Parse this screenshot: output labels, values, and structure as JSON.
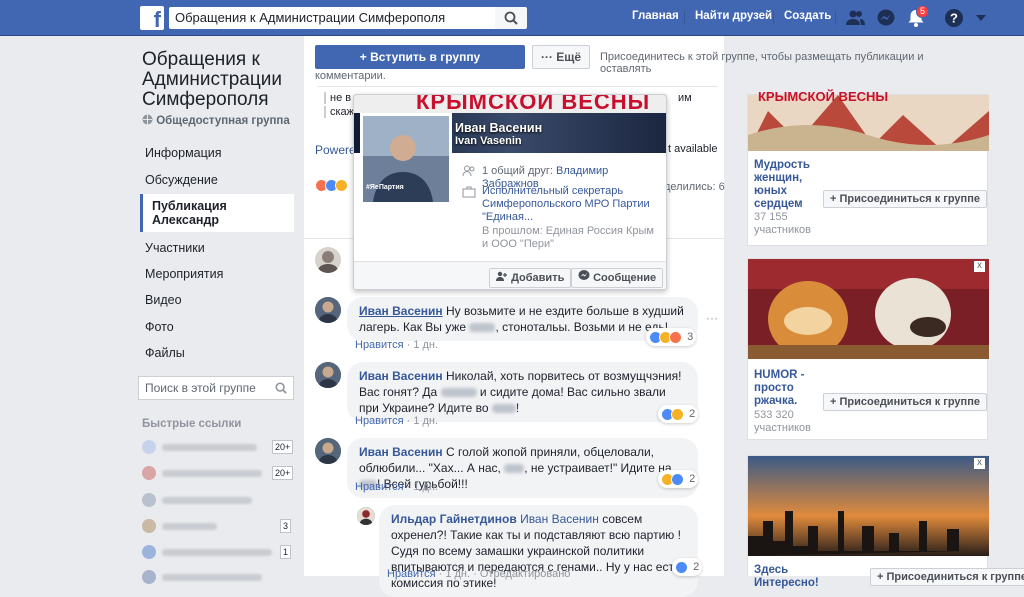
{
  "topbar": {
    "search_value": "Обращения к Администрации Симферополя",
    "nav": [
      "Главная",
      "Найти друзей",
      "Создать"
    ],
    "notif_count": "5",
    "icons": [
      "friends-icon",
      "messenger-icon",
      "bell-icon",
      "help-icon",
      "chevron-down-icon"
    ]
  },
  "group": {
    "title": "Обращения к Администрации Симферополя",
    "type": "Общедоступная группа",
    "join_label": "+ Вступить в группу",
    "more_label": "··· Ещё",
    "join_note_1": "Присоединитесь к этой группе, чтобы размещать публикации и оставлять",
    "join_note_2": "комментарии."
  },
  "menu": [
    "Информация",
    "Обсуждение",
    "Публикация Александр",
    "Участники",
    "Мероприятия",
    "Видео",
    "Фото",
    "Файлы"
  ],
  "group_search_placeholder": "Поиск в этой группе",
  "quick_links": {
    "title": "Быстрые ссылки",
    "counts": [
      "20+",
      "20+",
      "",
      "3",
      "1",
      ""
    ]
  },
  "post_fragments": {
    "line1": "не в",
    "line1b": "им",
    "line2": "скажу",
    "powered": "Powere",
    "not_avail": "t available",
    "shares": "делились: 6"
  },
  "hovercard": {
    "name": "Иван Васенин",
    "name_latin": "Ivan Vasenin",
    "banner_text": "КРЫМСКОЙ ВЕСНЫ",
    "photo_caption": "#ЯеПартия",
    "mutual_prefix": "1 общий друг:",
    "mutual_name": "Владимир Забражнов",
    "job": "Исполнительный секретарь Симферопольского МРО Партии \"Единая...",
    "past": "В прошлом: Единая Россия Крым и ООО \"Пери\"",
    "add_label": "Добавить",
    "message_label": "Сообщение"
  },
  "comments": [
    {
      "name": "Иван Васенин",
      "text_a": "Ну возьмите и не ездите больше в худший лагерь. Как Вы уже",
      "text_b": ", стонотальы. Возьми и не едь!",
      "like": "Нравится",
      "time": "1 дн.",
      "reactions": "3"
    },
    {
      "name": "Иван Васенин",
      "text_a": "Николай, хоть порвитесь от возмущчэния! Вас гонят? Да",
      "text_b": "и сидите дома! Вас сильно звали при Украине? Идите во",
      "like": "Нравится",
      "time": "1 дн.",
      "reactions": "2"
    },
    {
      "name": "Иван Васенин",
      "text_a": "С голой жопой приняли, обцеловали, облюбили... \"Хах... А нас,",
      "text_b": ", не устраивает!\" Идите на",
      "text_c": "! Всей гурьбой!!!",
      "like": "Нравится",
      "time": "1 дн.",
      "reactions": "2"
    },
    {
      "name": "Ильдар Гайнетдинов",
      "reply_to": "Иван Васенин",
      "text": "совсем охренел?! Такие как ты и подставляют всю партию ! Судя по всему замашки украинской политики впитываются и передаются с генами.. Ну у нас есть комиссия по этике!",
      "like": "Нравится",
      "time": "1 дн.",
      "extra": "Отредактировано",
      "reactions": "2"
    }
  ],
  "ads": [
    {
      "title": "Мудрость женщин, юных сердцем",
      "members": "37 155 участников",
      "join": "+ Присоединиться к группе",
      "banner": "КРЫМСКОЙ ВЕСНЫ"
    },
    {
      "title": "HUMOR - просто ржачка.",
      "members": "533 320 участников",
      "join": "+ Присоединиться к группе"
    },
    {
      "title": "Здесь Интересно!",
      "join": "+ Присоединиться к группе"
    }
  ]
}
